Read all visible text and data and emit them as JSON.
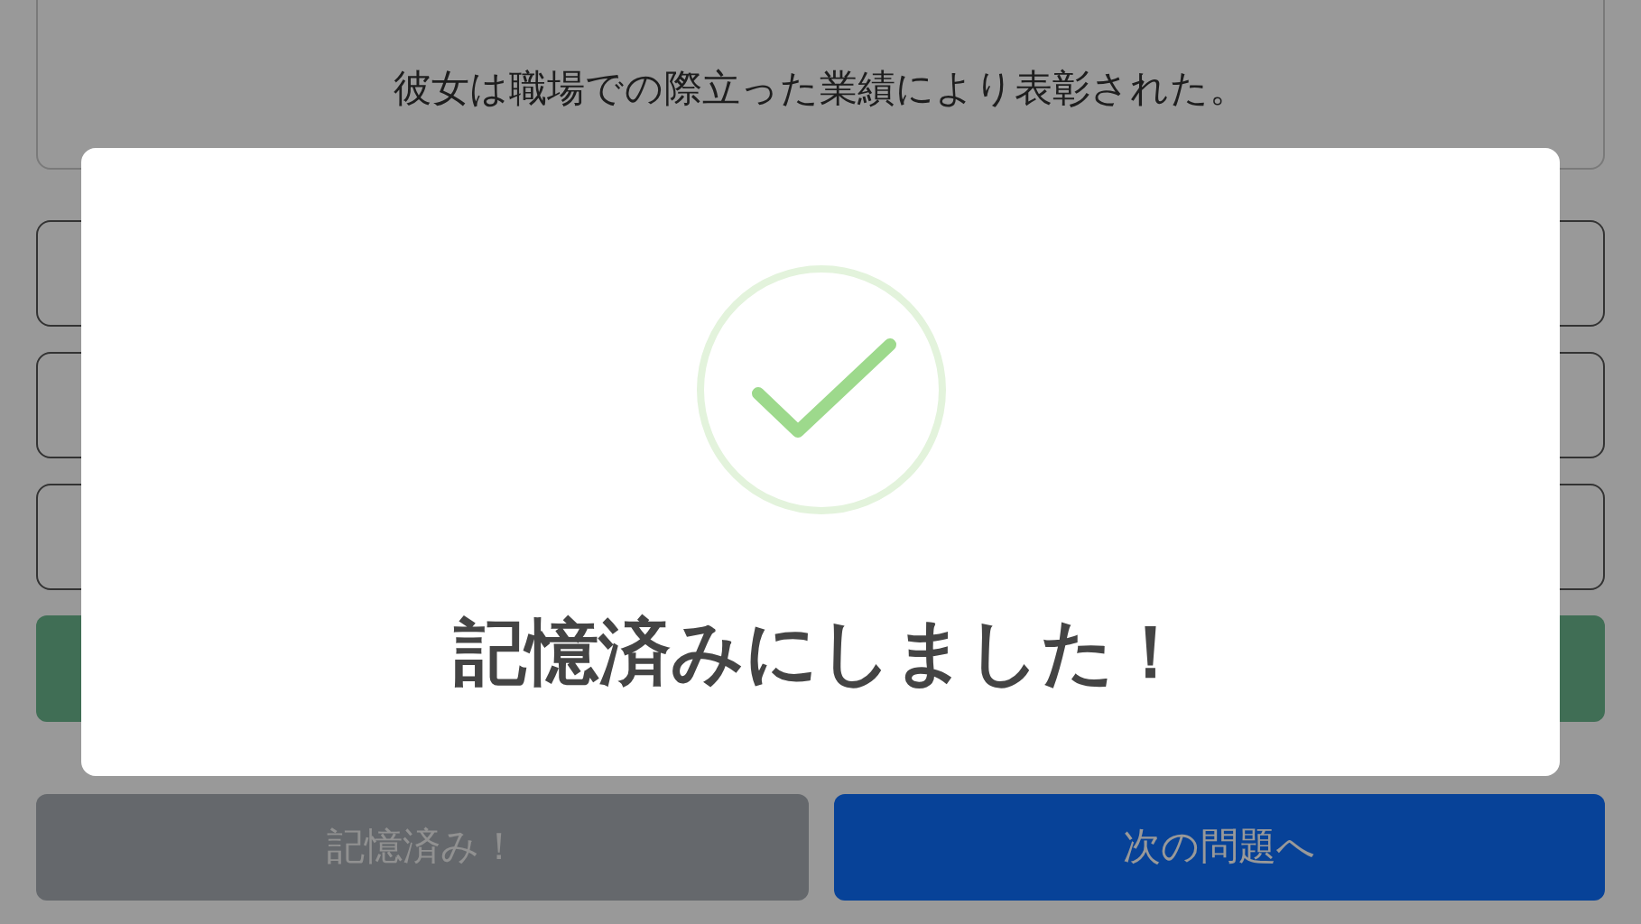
{
  "question_card": {
    "sentence": "彼女は職場での際立った業績により表彰された。"
  },
  "choices": [
    {
      "kind": "choice"
    },
    {
      "kind": "choice"
    },
    {
      "kind": "choice"
    }
  ],
  "buttons": [
    {
      "label": "記憶済み！",
      "disabled": true,
      "kind": "memorized"
    },
    {
      "label": "次の問題へ",
      "disabled": false,
      "kind": "next"
    }
  ],
  "dialog": {
    "message": "記憶済みにしました！"
  }
}
